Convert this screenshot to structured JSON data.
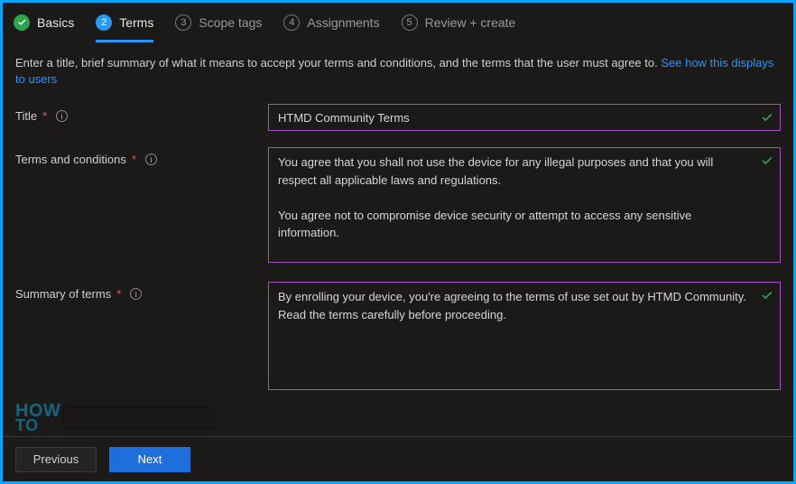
{
  "tabs": [
    {
      "label": "Basics",
      "state": "done"
    },
    {
      "num": "2",
      "label": "Terms",
      "state": "active"
    },
    {
      "num": "3",
      "label": "Scope tags",
      "state": "pending"
    },
    {
      "num": "4",
      "label": "Assignments",
      "state": "pending"
    },
    {
      "num": "5",
      "label": "Review + create",
      "state": "pending"
    }
  ],
  "intro_text": "Enter a title, brief summary of what it means to accept your terms and conditions, and the terms that the user must agree to. ",
  "intro_link": "See how this displays to users",
  "fields": {
    "title": {
      "label": "Title",
      "value": "HTMD Community Terms"
    },
    "terms": {
      "label": "Terms and conditions",
      "value": "You agree that you shall not use the device for any illegal purposes and that you will respect all applicable laws and regulations.\n\nYou agree not to compromise device security or attempt to access any sensitive information."
    },
    "summary": {
      "label": "Summary of terms",
      "value": "By enrolling your device, you're agreeing to the terms of use set out by HTMD Community. Read the terms carefully before proceeding."
    }
  },
  "buttons": {
    "previous": "Previous",
    "next": "Next"
  },
  "watermark": {
    "how": "HOW",
    "to": "TO",
    "brand": "MANAGE DEVICES"
  }
}
